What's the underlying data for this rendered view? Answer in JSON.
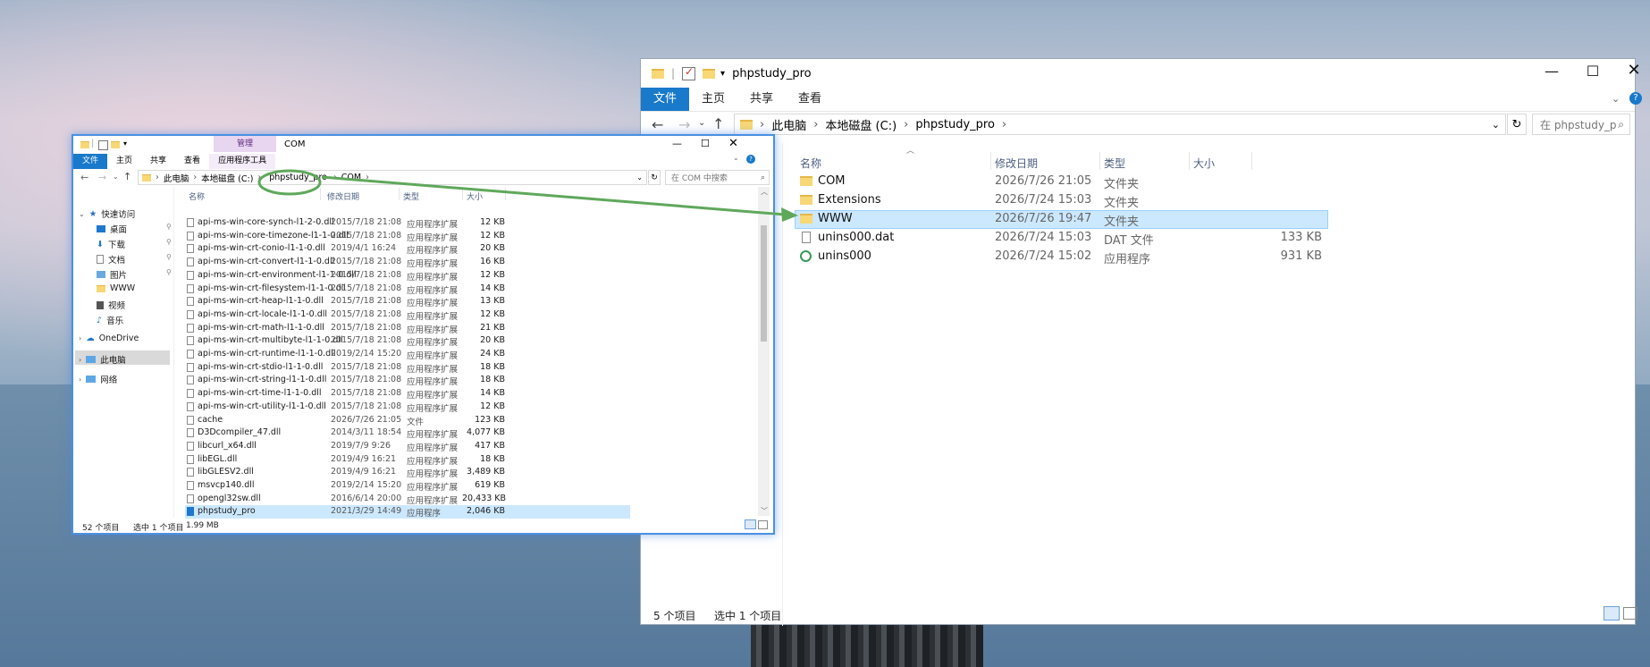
{
  "right_window": {
    "title": "phpstudy_pro",
    "tabs": [
      "文件",
      "主页",
      "共享",
      "查看"
    ],
    "path": [
      "此电脑",
      "本地磁盘 (C:)",
      "phpstudy_pro"
    ],
    "search_placeholder": "在 phpstudy_pro 中搜索",
    "columns": {
      "name": "名称",
      "date": "修改日期",
      "type": "类型",
      "size": "大小"
    },
    "files": [
      {
        "name": "COM",
        "date": "2026/7/26 21:05",
        "type": "文件夹",
        "size": "",
        "icon": "folder-icon"
      },
      {
        "name": "Extensions",
        "date": "2026/7/24 15:03",
        "type": "文件夹",
        "size": "",
        "icon": "folder-icon"
      },
      {
        "name": "WWW",
        "date": "2026/7/26 19:47",
        "type": "文件夹",
        "size": "",
        "icon": "folder-icon"
      },
      {
        "name": "unins000.dat",
        "date": "2026/7/24 15:03",
        "type": "DAT 文件",
        "size": "133 KB",
        "icon": "file-icon"
      },
      {
        "name": "unins000",
        "date": "2026/7/24 15:02",
        "type": "应用程序",
        "size": "931 KB",
        "icon": "uninstall-app-icon"
      }
    ],
    "status": {
      "count": "5 个项目",
      "selected": "选中 1 个项目"
    }
  },
  "left_window": {
    "title": "COM",
    "context_tab": "管理",
    "context_tools": "应用程序工具",
    "tabs": [
      "文件",
      "主页",
      "共享",
      "查看"
    ],
    "path": [
      "此电脑",
      "本地磁盘 (C:)",
      "phpstudy_pro",
      "COM"
    ],
    "search_placeholder": "在 COM 中搜索",
    "columns": {
      "name": "名称",
      "date": "修改日期",
      "type": "类型",
      "size": "大小"
    },
    "nav": [
      {
        "label": "快速访问",
        "icon": "star-icon"
      },
      {
        "label": "桌面",
        "icon": "desktop-icon"
      },
      {
        "label": "下载",
        "icon": "download-icon"
      },
      {
        "label": "文档",
        "icon": "document-icon"
      },
      {
        "label": "图片",
        "icon": "picture-icon"
      },
      {
        "label": "WWW",
        "icon": "folder-icon"
      },
      {
        "label": "视频",
        "icon": "video-icon"
      },
      {
        "label": "音乐",
        "icon": "music-icon"
      },
      {
        "label": "OneDrive",
        "icon": "cloud-icon"
      },
      {
        "label": "此电脑",
        "icon": "computer-icon"
      },
      {
        "label": "网络",
        "icon": "network-icon"
      }
    ],
    "files": [
      {
        "name": "api-ms-win-core-synch-l1-2-0.dll",
        "date": "2015/7/18 21:08",
        "type": "应用程序扩展",
        "size": "12 KB"
      },
      {
        "name": "api-ms-win-core-timezone-l1-1-0.dll",
        "date": "2015/7/18 21:08",
        "type": "应用程序扩展",
        "size": "12 KB"
      },
      {
        "name": "api-ms-win-crt-conio-l1-1-0.dll",
        "date": "2019/4/1 16:24",
        "type": "应用程序扩展",
        "size": "20 KB"
      },
      {
        "name": "api-ms-win-crt-convert-l1-1-0.dll",
        "date": "2015/7/18 21:08",
        "type": "应用程序扩展",
        "size": "16 KB"
      },
      {
        "name": "api-ms-win-crt-environment-l1-1-0.dll",
        "date": "2015/7/18 21:08",
        "type": "应用程序扩展",
        "size": "12 KB"
      },
      {
        "name": "api-ms-win-crt-filesystem-l1-1-0.dll",
        "date": "2015/7/18 21:08",
        "type": "应用程序扩展",
        "size": "14 KB"
      },
      {
        "name": "api-ms-win-crt-heap-l1-1-0.dll",
        "date": "2015/7/18 21:08",
        "type": "应用程序扩展",
        "size": "13 KB"
      },
      {
        "name": "api-ms-win-crt-locale-l1-1-0.dll",
        "date": "2015/7/18 21:08",
        "type": "应用程序扩展",
        "size": "12 KB"
      },
      {
        "name": "api-ms-win-crt-math-l1-1-0.dll",
        "date": "2015/7/18 21:08",
        "type": "应用程序扩展",
        "size": "21 KB"
      },
      {
        "name": "api-ms-win-crt-multibyte-l1-1-0.dll",
        "date": "2015/7/18 21:08",
        "type": "应用程序扩展",
        "size": "20 KB"
      },
      {
        "name": "api-ms-win-crt-runtime-l1-1-0.dll",
        "date": "2019/2/14 15:20",
        "type": "应用程序扩展",
        "size": "24 KB"
      },
      {
        "name": "api-ms-win-crt-stdio-l1-1-0.dll",
        "date": "2015/7/18 21:08",
        "type": "应用程序扩展",
        "size": "18 KB"
      },
      {
        "name": "api-ms-win-crt-string-l1-1-0.dll",
        "date": "2015/7/18 21:08",
        "type": "应用程序扩展",
        "size": "18 KB"
      },
      {
        "name": "api-ms-win-crt-time-l1-1-0.dll",
        "date": "2015/7/18 21:08",
        "type": "应用程序扩展",
        "size": "14 KB"
      },
      {
        "name": "api-ms-win-crt-utility-l1-1-0.dll",
        "date": "2015/7/18 21:08",
        "type": "应用程序扩展",
        "size": "12 KB"
      },
      {
        "name": "cache",
        "date": "2026/7/26 21:05",
        "type": "文件",
        "size": "123 KB"
      },
      {
        "name": "D3Dcompiler_47.dll",
        "date": "2014/3/11 18:54",
        "type": "应用程序扩展",
        "size": "4,077 KB"
      },
      {
        "name": "libcurl_x64.dll",
        "date": "2019/7/9 9:26",
        "type": "应用程序扩展",
        "size": "417 KB"
      },
      {
        "name": "libEGL.dll",
        "date": "2019/4/9 16:21",
        "type": "应用程序扩展",
        "size": "18 KB"
      },
      {
        "name": "libGLESV2.dll",
        "date": "2019/4/9 16:21",
        "type": "应用程序扩展",
        "size": "3,489 KB"
      },
      {
        "name": "msvcp140.dll",
        "date": "2019/2/14 15:20",
        "type": "应用程序扩展",
        "size": "619 KB"
      },
      {
        "name": "opengl32sw.dll",
        "date": "2016/6/14 20:00",
        "type": "应用程序扩展",
        "size": "20,433 KB"
      },
      {
        "name": "phpstudy_pro",
        "date": "2021/3/29 14:49",
        "type": "应用程序",
        "size": "2,046 KB"
      }
    ],
    "status": {
      "count": "52 个项目",
      "selected": "选中 1 个项目",
      "size": "1.99 MB"
    }
  },
  "colors": {
    "accent": "#1979ca",
    "selection": "#cce8ff",
    "annotation": "#5fa85b",
    "window_border": "#4a90e2"
  }
}
